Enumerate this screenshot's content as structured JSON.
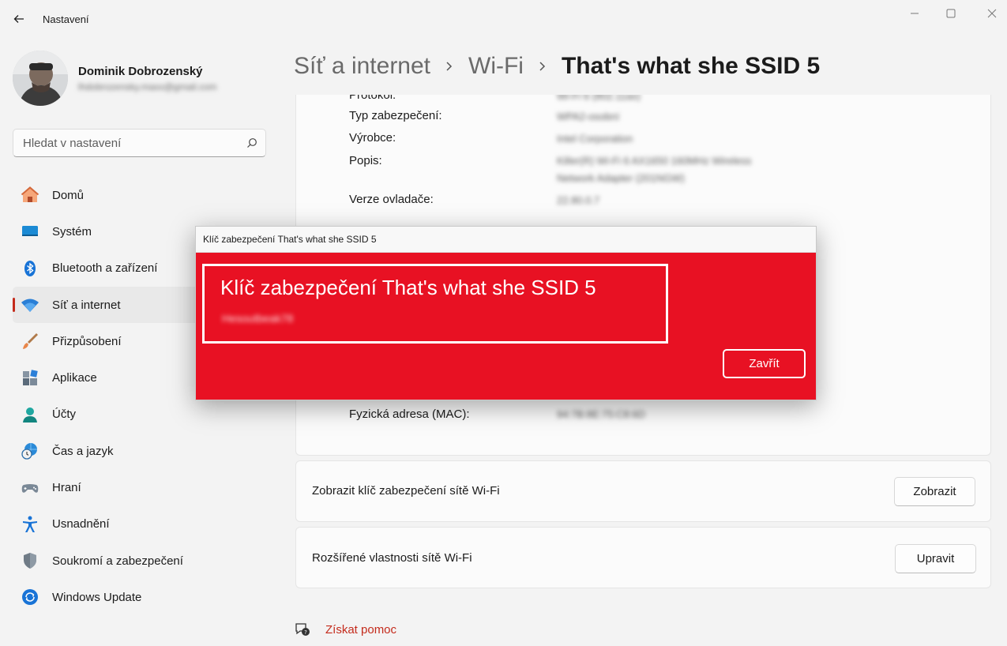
{
  "app": {
    "title": "Nastavení"
  },
  "user": {
    "name": "Dominik Dobrozenský",
    "email": "lhdobrozensky.maxx@gmail.com"
  },
  "search": {
    "placeholder": "Hledat v nastavení"
  },
  "sidebar": {
    "items": [
      {
        "label": "Domů",
        "icon": "home-icon"
      },
      {
        "label": "Systém",
        "icon": "system-icon"
      },
      {
        "label": "Bluetooth a zařízení",
        "icon": "bluetooth-icon"
      },
      {
        "label": "Síť a internet",
        "icon": "wifi-icon",
        "active": true
      },
      {
        "label": "Přizpůsobení",
        "icon": "brush-icon"
      },
      {
        "label": "Aplikace",
        "icon": "apps-icon"
      },
      {
        "label": "Účty",
        "icon": "account-icon"
      },
      {
        "label": "Čas a jazyk",
        "icon": "clock-globe-icon"
      },
      {
        "label": "Hraní",
        "icon": "gamepad-icon"
      },
      {
        "label": "Usnadnění",
        "icon": "accessibility-icon"
      },
      {
        "label": "Soukromí a zabezpečení",
        "icon": "shield-icon"
      },
      {
        "label": "Windows Update",
        "icon": "update-icon"
      }
    ]
  },
  "breadcrumb": {
    "items": [
      "Síť a internet",
      "Wi-Fi",
      "That's what she SSID 5"
    ]
  },
  "properties": {
    "rows": [
      {
        "label": "Protokol:",
        "value": "Wi-Fi 6 (802.11ax)"
      },
      {
        "label": "Typ zabezpečení:",
        "value": "WPA2-osobní"
      },
      {
        "label": "Výrobce:",
        "value": "Intel Corporation"
      },
      {
        "label": "Popis:",
        "value": "Killer(R) Wi-Fi 6 AX1650 160MHz Wireless",
        "value2": "Network Adapter (201NGW)"
      },
      {
        "label": "Verze ovladače:",
        "value": "22.80.0.7"
      },
      {
        "label": "Fyzická adresa (MAC):",
        "value": "94:7B:8E:75:C8:6D"
      }
    ]
  },
  "show_key": {
    "label": "Zobrazit klíč zabezpečení sítě Wi-Fi",
    "button": "Zobrazit"
  },
  "advanced": {
    "label": "Rozšířené vlastnosti sítě Wi-Fi",
    "button": "Upravit"
  },
  "help": {
    "label": "Získat pomoc"
  },
  "dialog": {
    "title": "Klíč zabezpečení That's what she SSID 5",
    "heading": "Klíč zabezpečení That's what she SSID 5",
    "key": "Hesoutbeak78",
    "close_button": "Zavřít"
  },
  "colors": {
    "accent": "#c42b1c",
    "dialog_bg": "#e81123"
  }
}
